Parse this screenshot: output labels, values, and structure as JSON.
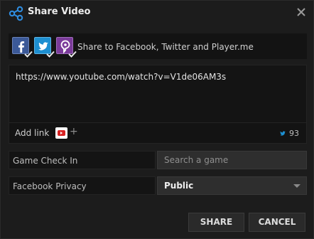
{
  "header": {
    "title": "Share Video",
    "icons": {
      "share": "share-nodes-icon",
      "close": "close-icon"
    }
  },
  "share_to": {
    "services": [
      {
        "name": "facebook-icon",
        "checked": true,
        "color": "#3b5998"
      },
      {
        "name": "twitter-icon",
        "checked": true,
        "color": "#1d8fd1"
      },
      {
        "name": "playerme-icon",
        "checked": true,
        "color": "#7b3b9a"
      }
    ],
    "label": "Share to Facebook, Twitter and Player.me"
  },
  "message": {
    "text": "https://www.youtube.com/watch?v=V1de06AM3s"
  },
  "link": {
    "label": "Add link",
    "icons": {
      "youtube": "youtube-icon",
      "add": "plus-icon"
    },
    "add_symbol": "+",
    "twitter_remaining": "93"
  },
  "game_check_in": {
    "label": "Game Check In",
    "placeholder": "Search a game"
  },
  "facebook_privacy": {
    "label": "Facebook Privacy",
    "selected": "Public"
  },
  "buttons": {
    "share": "SHARE",
    "cancel": "CANCEL"
  },
  "colors": {
    "background": "#1c1c1c",
    "panel": "#141414",
    "field": "#2e2e2e",
    "accent_twitter": "#1d8fd1"
  }
}
